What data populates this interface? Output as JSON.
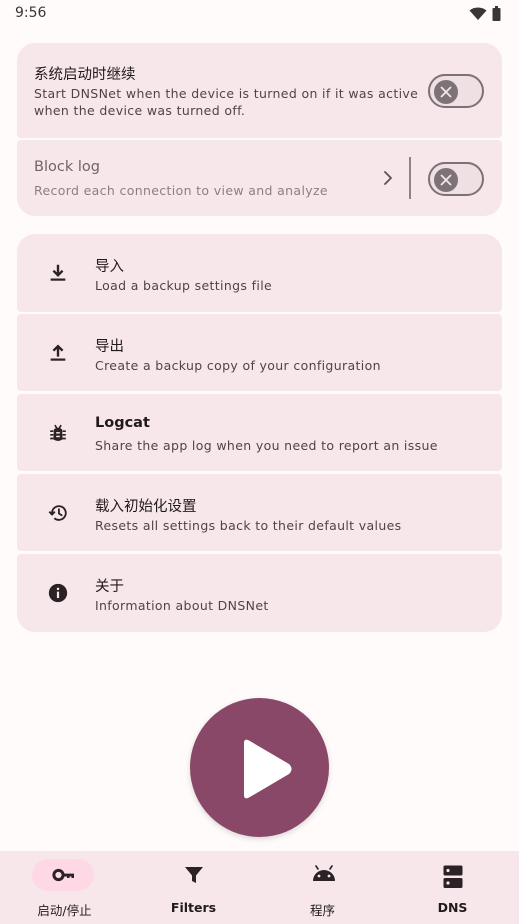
{
  "status_bar": {
    "time": "9:56"
  },
  "settings": {
    "startup": {
      "title": "系统启动时继续",
      "desc_line1": "Start DNSNet when the device is turned on if it was active",
      "desc_line2": "when the device was turned off.",
      "enabled": false
    },
    "block_log": {
      "title": "Block log",
      "desc": "Record each connection to view and analyze",
      "enabled": false
    }
  },
  "actions": [
    {
      "icon": "download-icon",
      "title": "导入",
      "desc": "Load a backup settings file"
    },
    {
      "icon": "upload-icon",
      "title": "导出",
      "desc": "Create a backup copy of your configuration"
    },
    {
      "icon": "bug-icon",
      "title": "Logcat",
      "desc": "Share the app log when you need to report an issue"
    },
    {
      "icon": "history-icon",
      "title": "载入初始化设置",
      "desc": "Resets all settings back to their default values"
    },
    {
      "icon": "info-icon",
      "title": "关于",
      "desc": "Information about DNSNet"
    }
  ],
  "fab": {
    "icon": "play-icon"
  },
  "bottom_nav": [
    {
      "icon": "key-icon",
      "label": "启动/停止",
      "selected": true
    },
    {
      "icon": "filter-icon",
      "label": "Filters",
      "selected": false
    },
    {
      "icon": "android-icon",
      "label": "程序",
      "selected": false
    },
    {
      "icon": "dns-icon",
      "label": "DNS",
      "selected": false
    }
  ],
  "colors": {
    "card": "#f8e7ea",
    "accent": "#8a4868",
    "nav_pill": "#ffd8e6",
    "background": "#fffbfb"
  }
}
